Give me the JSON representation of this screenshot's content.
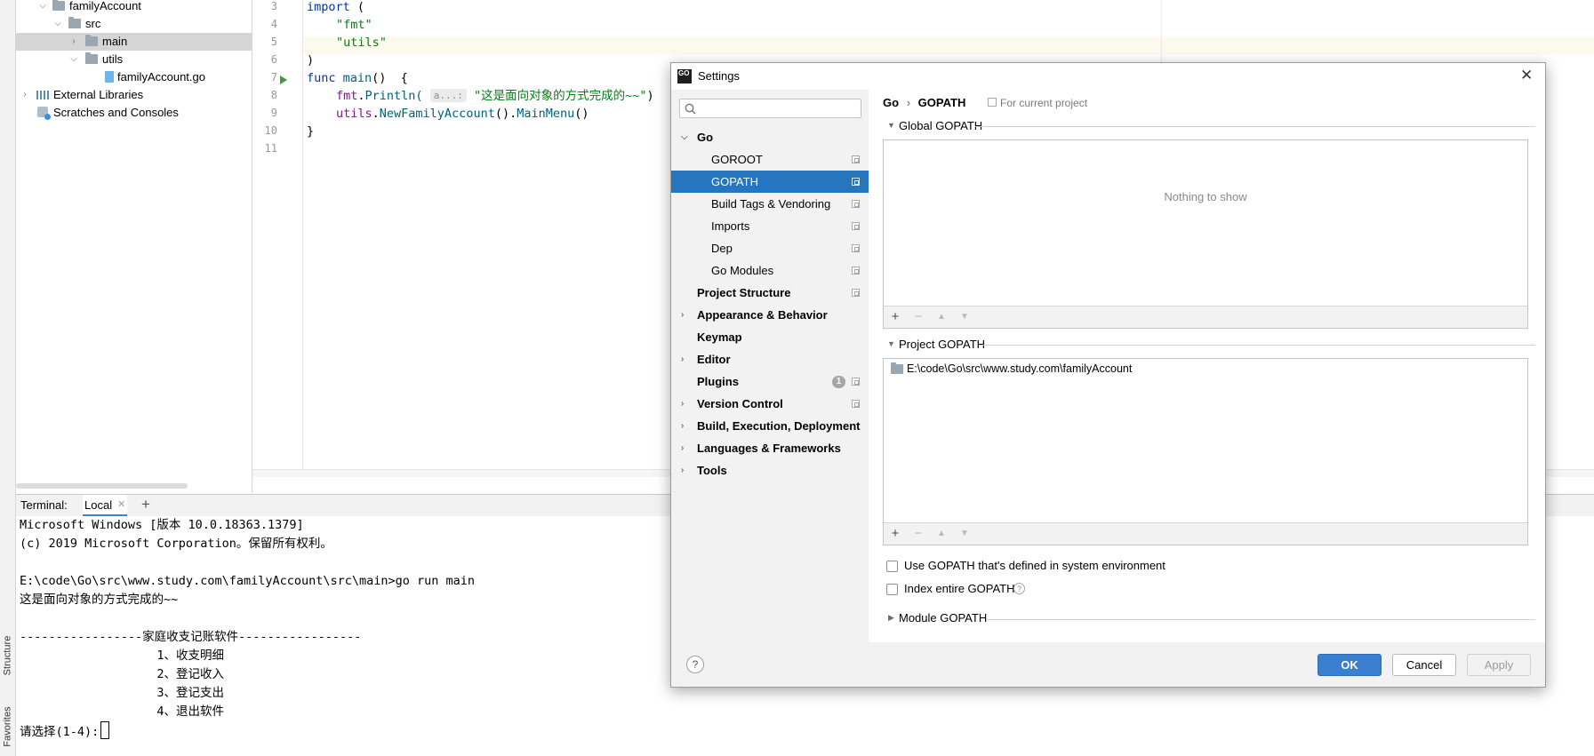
{
  "tool_strip": {
    "structure_label": "Structure",
    "favorites_label": "Favorites"
  },
  "project_tree": {
    "items": [
      {
        "label": "familyAccount",
        "type": "folder",
        "expanded": true
      },
      {
        "label": "src",
        "type": "folder",
        "expanded": true
      },
      {
        "label": "main",
        "type": "folder",
        "expanded": false,
        "selected": true
      },
      {
        "label": "utils",
        "type": "folder",
        "expanded": true
      },
      {
        "label": "familyAccount.go",
        "type": "go-file"
      },
      {
        "label": "External Libraries",
        "type": "library",
        "expanded": false
      },
      {
        "label": "Scratches and Consoles",
        "type": "scratches"
      }
    ]
  },
  "editor": {
    "line_numbers": [
      "3",
      "4",
      "5",
      "6",
      "7",
      "8",
      "9",
      "10",
      "11"
    ],
    "lines": {
      "l3_kw": "import",
      "l3_rest": " (",
      "l4_str": "\"fmt\"",
      "l5_str": "\"utils\"",
      "l6": ")",
      "l7_kw": "func",
      "l7_fn": "main",
      "l7_rest": "()  {",
      "l8_pkg": "fmt",
      "l8_fn": "Println(",
      "l8_hint": "a...:",
      "l8_str": "\"这是面向对象的方式完成的~~\"",
      "l8_close": ")",
      "l9_pkg": "utils",
      "l9_fn": "NewFamilyAccount",
      "l9_mid": "().",
      "l9_fn2": "MainMenu",
      "l9_close": "()",
      "l10": "}"
    }
  },
  "terminal": {
    "label": "Terminal:",
    "tab_label": "Local",
    "lines": [
      "Microsoft Windows [版本 10.0.18363.1379]",
      "(c) 2019 Microsoft Corporation。保留所有权利。",
      "",
      "E:\\code\\Go\\src\\www.study.com\\familyAccount\\src\\main>go run main",
      "这是面向对象的方式完成的~~",
      "",
      "-----------------家庭收支记账软件-----------------",
      "                   1、收支明细",
      "                   2、登记收入",
      "                   3、登记支出",
      "                   4、退出软件"
    ],
    "prompt": "请选择(1-4):"
  },
  "dialog": {
    "title": "Settings",
    "breadcrumb_root": "Go",
    "breadcrumb_current": "GOPATH",
    "scope_label": "For current project",
    "nav_items": [
      {
        "label": "Go",
        "bold": true,
        "expandable": true,
        "expanded": true
      },
      {
        "label": "GOROOT",
        "indent": true,
        "project": true
      },
      {
        "label": "GOPATH",
        "indent": true,
        "project": true,
        "selected": true
      },
      {
        "label": "Build Tags & Vendoring",
        "indent": true,
        "project": true
      },
      {
        "label": "Imports",
        "indent": true,
        "project": true
      },
      {
        "label": "Dep",
        "indent": true,
        "project": true
      },
      {
        "label": "Go Modules",
        "indent": true,
        "project": true
      },
      {
        "label": "Project Structure",
        "bold": true,
        "project": true
      },
      {
        "label": "Appearance & Behavior",
        "bold": true,
        "expandable": true
      },
      {
        "label": "Keymap",
        "bold": true
      },
      {
        "label": "Editor",
        "bold": true,
        "expandable": true
      },
      {
        "label": "Plugins",
        "bold": true,
        "badge": "1",
        "project": true
      },
      {
        "label": "Version Control",
        "bold": true,
        "expandable": true,
        "project": true
      },
      {
        "label": "Build, Execution, Deployment",
        "bold": true,
        "expandable": true
      },
      {
        "label": "Languages & Frameworks",
        "bold": true,
        "expandable": true
      },
      {
        "label": "Tools",
        "bold": true,
        "expandable": true
      }
    ],
    "global_gopath": {
      "title": "Global GOPATH",
      "empty_text": "Nothing to show"
    },
    "project_gopath": {
      "title": "Project GOPATH",
      "entries": [
        "E:\\code\\Go\\src\\www.study.com\\familyAccount"
      ]
    },
    "use_system_gopath_label": "Use GOPATH that's defined in system environment",
    "index_entire_label": "Index entire GOPATH",
    "module_gopath_title": "Module GOPATH",
    "buttons": {
      "ok": "OK",
      "cancel": "Cancel",
      "apply": "Apply",
      "help": "?"
    }
  },
  "colors": {
    "selection_blue": "#2675bf",
    "ok_button": "#3b7fd0",
    "tree_selection": "#d5d5d5"
  }
}
